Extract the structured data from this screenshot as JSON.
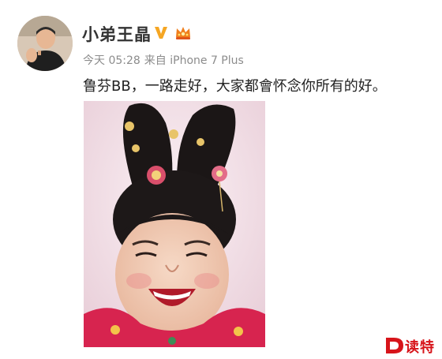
{
  "post": {
    "author": "小弟王晶",
    "meta": {
      "time": "今天 05:28",
      "source": "来自 iPhone 7 Plus"
    },
    "text": "鲁芬BB，一路走好，大家都會怀念你所有的好。"
  },
  "watermark": {
    "text": "读特",
    "color": "#d7141a"
  },
  "icons": {
    "verified": "verified-v-icon",
    "crown": "crown-icon",
    "watermark_logo": "d-logo-icon"
  },
  "colors": {
    "author": "#333333",
    "meta": "#8c8c8c",
    "verified": "#f5a623",
    "crown": "#f07f1c"
  }
}
